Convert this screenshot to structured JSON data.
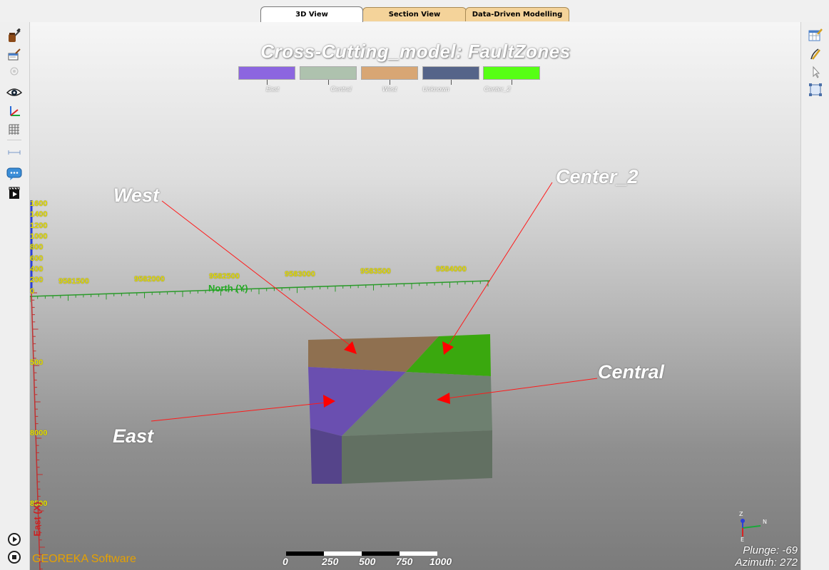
{
  "tabs": [
    "3D View",
    "Section View",
    "Data-Driven Modelling"
  ],
  "title": "Cross-Cutting_model: FaultZones",
  "legend": [
    {
      "label": "East",
      "color": "#8c66e0"
    },
    {
      "label": "Central",
      "color": "#aec2ae"
    },
    {
      "label": "West",
      "color": "#d8a674"
    },
    {
      "label": "Unknown",
      "color": "#556489"
    },
    {
      "label": "Center_2",
      "color": "#56ff14"
    }
  ],
  "annotations": {
    "west": "West",
    "center_2": "Center_2",
    "central": "Central",
    "east": "East"
  },
  "axes": {
    "north_label": "North (Y)",
    "north_ticks": [
      "9581500",
      "9582000",
      "9582500",
      "9583000",
      "9583500",
      "9584000"
    ],
    "z_ticks": [
      "1600",
      "1400",
      "1200",
      "1000",
      "800",
      "600",
      "400",
      "200",
      "0"
    ],
    "east_ticks": [
      "500",
      "8000",
      "8500"
    ],
    "east_label": "East (X)"
  },
  "brand": "GEOREKA Software",
  "scale_labels": [
    "0",
    "250",
    "500",
    "750",
    "1000"
  ],
  "plunge": "Plunge: -69",
  "azimuth": "Azimuth: 272",
  "mini_axes": {
    "z": "Z",
    "n": "N",
    "e": "E"
  },
  "colors": {
    "tab_active": "#ffffff",
    "tab_inactive": "#f4d39a",
    "brand": "#e6a100",
    "tick_text": "#e8e000",
    "arrow": "#ff0000"
  },
  "left_toolbar_icons": [
    "drill-hammer-icon",
    "edit-hammer-icon",
    "light-icon",
    "eye-icon",
    "axes-icon",
    "grid-icon",
    "ruler-icon",
    "comment-icon",
    "video-icon",
    "play-icon",
    "stop-icon"
  ],
  "right_toolbar_icons": [
    "table-edit-icon",
    "pencil-icon",
    "pointer-icon",
    "zoom-box-icon"
  ]
}
